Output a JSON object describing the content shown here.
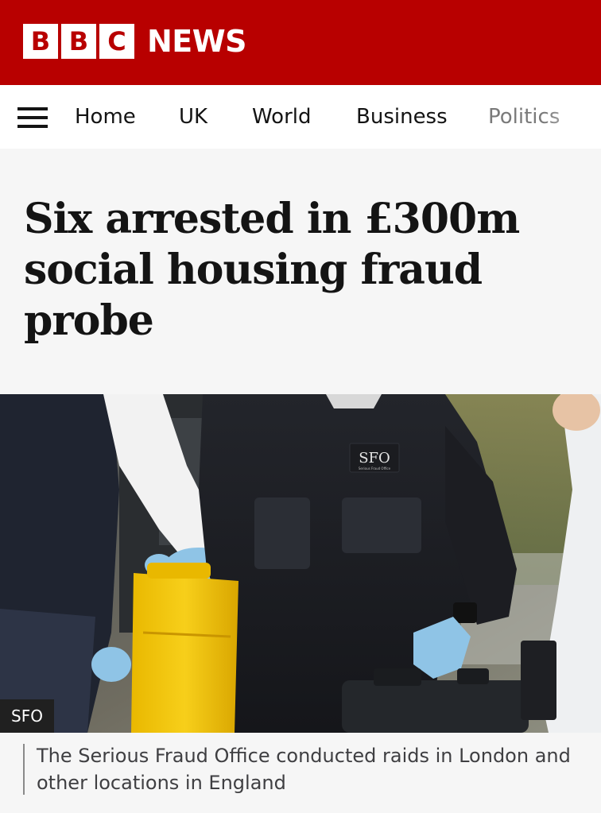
{
  "brand": {
    "letters": [
      "B",
      "B",
      "C"
    ],
    "word": "NEWS",
    "colors": {
      "red": "#b80000",
      "white": "#ffffff"
    }
  },
  "nav": {
    "menu_icon": "hamburger-menu-icon",
    "items": [
      "Home",
      "UK",
      "World",
      "Business",
      "Politics"
    ]
  },
  "article": {
    "headline": "Six arrested in £300m social housing fraud probe",
    "image": {
      "credit": "SFO",
      "vest_badge": "SFO",
      "vest_badge_sub": "Serious Fraud Office"
    },
    "caption": "The Serious Fraud Office conducted raids in London and other locations in England"
  }
}
